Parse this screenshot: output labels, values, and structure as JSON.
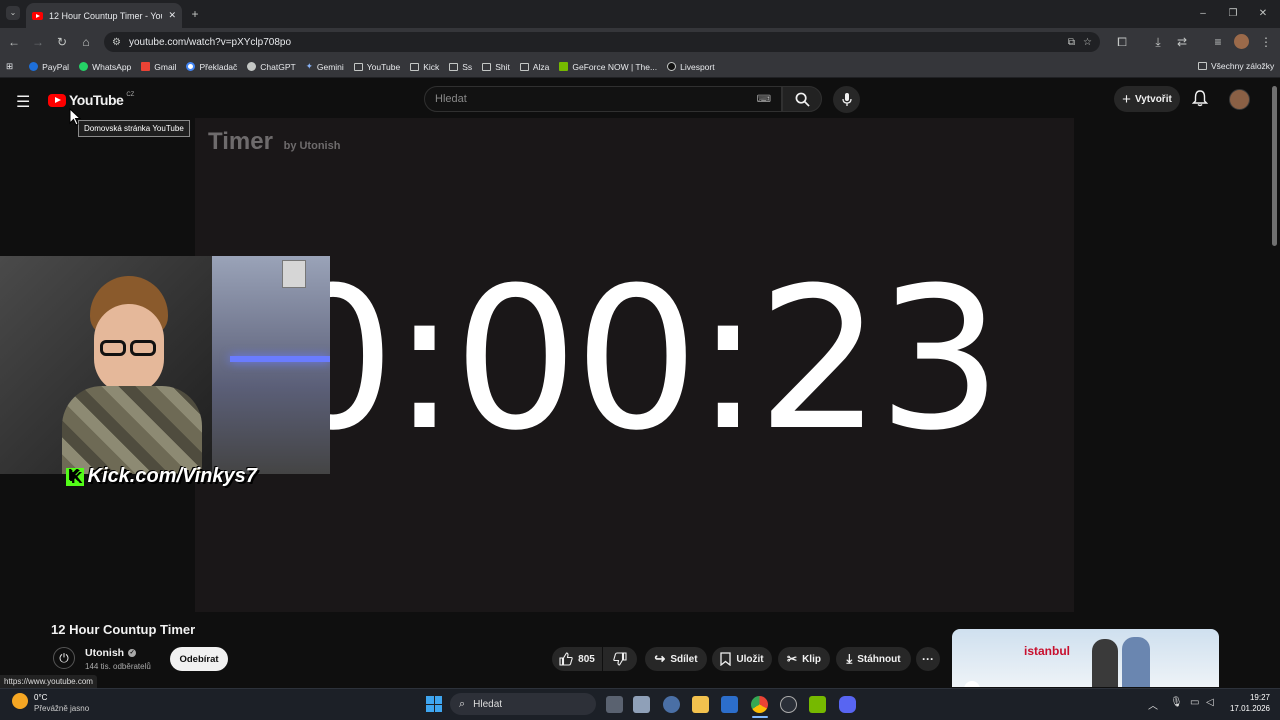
{
  "browser": {
    "tab_title": "12 Hour Countup Timer - YouTube",
    "new_tab": "+",
    "url": "youtube.com/watch?v=pXYclp708po",
    "window_controls": [
      "–",
      "❐",
      "✕"
    ],
    "bookmarks": [
      "PayPal",
      "WhatsApp",
      "Gmail",
      "Překladač",
      "ChatGPT",
      "Gemini",
      "YouTube",
      "Kick",
      "Ss",
      "Shit",
      "Alza",
      "GeForce NOW | The...",
      "Livesport"
    ],
    "all_bookmarks": "Všechny záložky"
  },
  "youtube": {
    "logo": "YouTube",
    "region": "CZ",
    "tooltip": "Domovská stránka YouTube",
    "search_placeholder": "Hledat",
    "create_label": "Vytvořit"
  },
  "video": {
    "timer_text": "0:00:23",
    "watermark": "Timer",
    "watermark_by": "by Utonish",
    "webcam_label": "Kick.com/Vinkys7",
    "kick_logo_letter": "K",
    "title": "12 Hour Countup Timer"
  },
  "channel": {
    "name": "Utonish",
    "subscribers": "144 tis. odběratelů",
    "subscribe_label": "Odebírat"
  },
  "actions": {
    "likes": "805",
    "share": "Sdílet",
    "save": "Uložit",
    "clip": "Klip",
    "download": "Stáhnout",
    "more": "···"
  },
  "ad": {
    "text": "istanbul"
  },
  "status_url": "https://www.youtube.com",
  "taskbar": {
    "temperature": "0°C",
    "weather": "Převážně jasno",
    "search_placeholder": "Hledat",
    "time": "19:27",
    "date": "17.01.2026"
  },
  "colors": {
    "youtube_red": "#ff0000",
    "kick_green": "#53fc18",
    "background": "#0f0f0f"
  }
}
